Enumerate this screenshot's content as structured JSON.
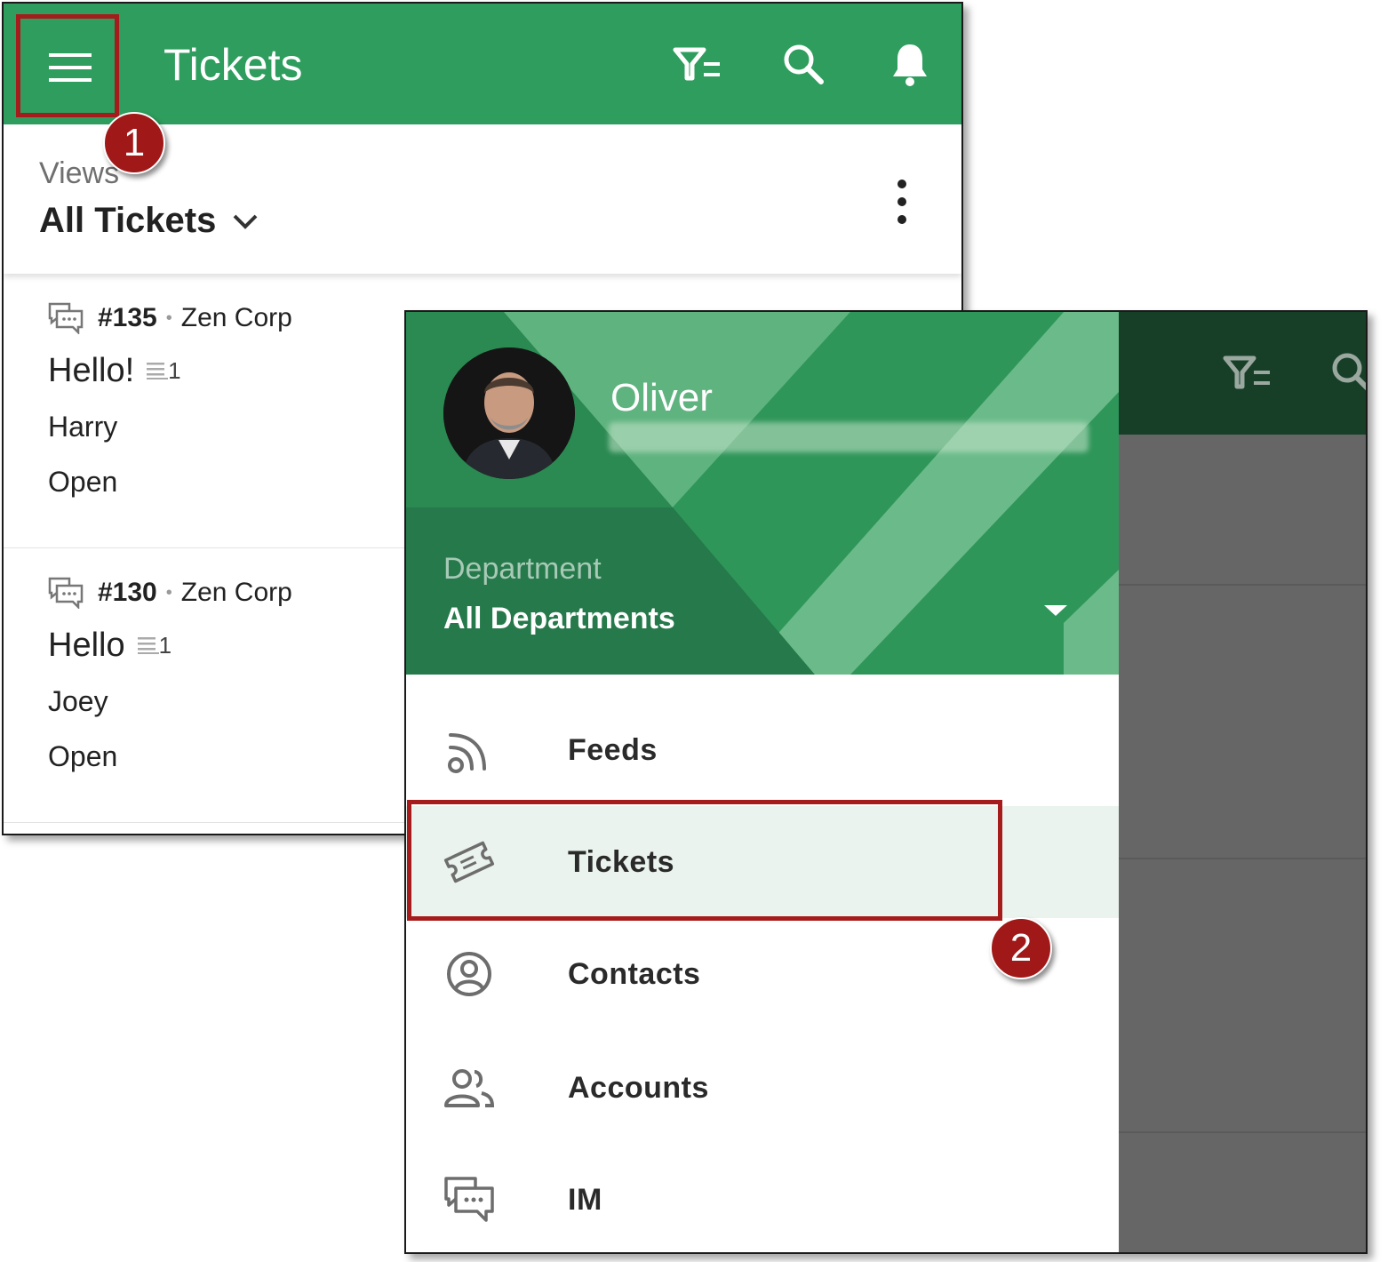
{
  "screen1": {
    "appbar": {
      "title": "Tickets",
      "icons": [
        "menu-icon",
        "filter-icon",
        "search-icon",
        "bell-icon"
      ],
      "color": "#2e9d5d"
    },
    "views": {
      "label": "Views",
      "value": "All Tickets"
    },
    "tickets": [
      {
        "id": "#135",
        "account": "Zen Corp",
        "subject": "Hello!",
        "thread_count": "1",
        "contact": "Harry",
        "status": "Open"
      },
      {
        "id": "#130",
        "account": "Zen Corp",
        "subject": "Hello",
        "thread_count": "1",
        "contact": "Joey",
        "status": "Open"
      }
    ]
  },
  "screen2": {
    "user": {
      "name": "Oliver"
    },
    "department": {
      "label": "Department",
      "value": "All Departments"
    },
    "nav": [
      {
        "label": "Feeds",
        "icon": "feeds-icon",
        "active": false
      },
      {
        "label": "Tickets",
        "icon": "ticket-icon",
        "active": true
      },
      {
        "label": "Contacts",
        "icon": "contact-icon",
        "active": false
      },
      {
        "label": "Accounts",
        "icon": "accounts-icon",
        "active": false
      },
      {
        "label": "IM",
        "icon": "chat-icon",
        "active": false
      }
    ]
  },
  "callouts": {
    "step1": "1",
    "step2": "2",
    "color": "#a01818"
  }
}
